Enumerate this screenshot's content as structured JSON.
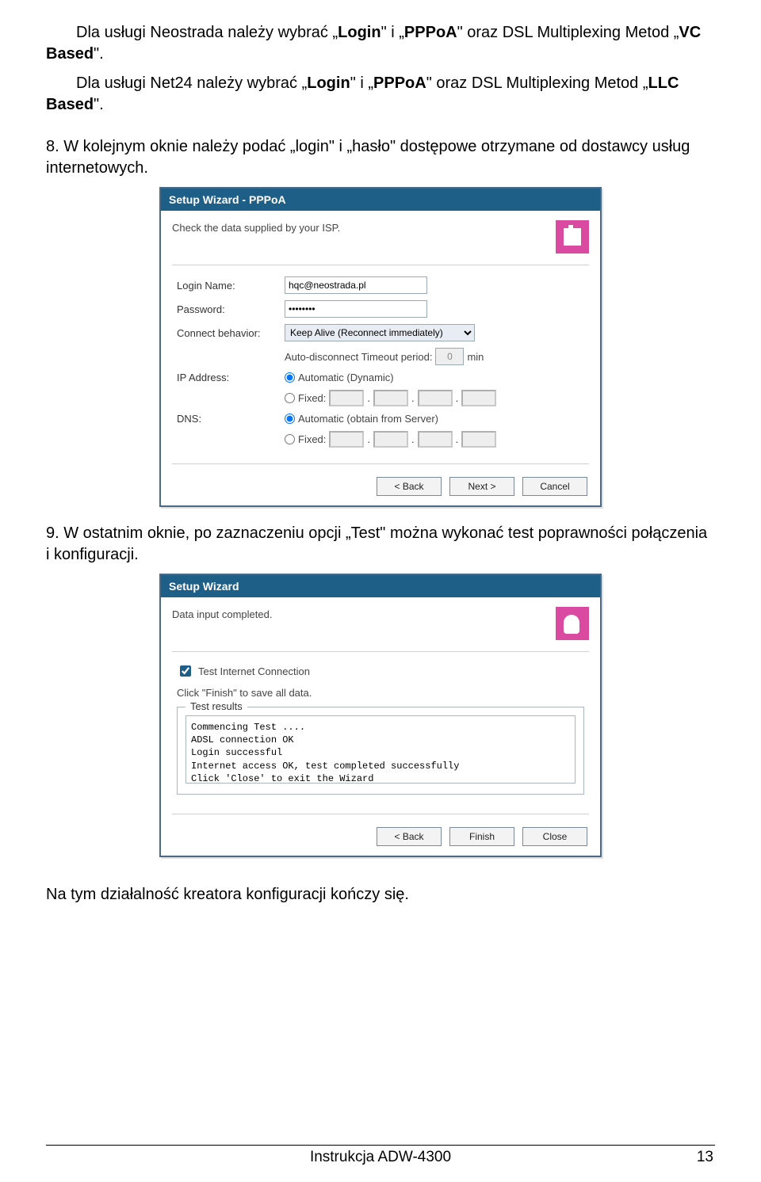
{
  "text": {
    "intro1_pre": "Dla usługi Neostrada należy wybrać „",
    "intro1_b1": "Login",
    "intro1_mid": "\" i „",
    "intro1_b2": "PPPoA",
    "intro1_after": "\" oraz DSL Multiplexing Metod „",
    "intro1_b3": "VC Based",
    "intro1_end": "\".",
    "intro2_pre": "Dla usługi Net24 należy wybrać „",
    "intro2_b1": "Login",
    "intro2_mid": "\" i „",
    "intro2_b2": "PPPoA",
    "intro2_after": "\" oraz DSL Multiplexing Metod „",
    "intro2_b3": "LLC Based",
    "intro2_end": "\".",
    "step8": "8. W kolejnym oknie należy podać „login\" i „hasło\" dostępowe otrzymane od dostawcy usług internetowych.",
    "step9": "9. W ostatnim oknie, po zaznaczeniu opcji „Test\" można wykonać test poprawności połączenia i konfiguracji.",
    "closing": "Na tym działalność kreatora konfiguracji kończy się."
  },
  "wizard1": {
    "title": "Setup Wizard - PPPoA",
    "intro": "Check the data supplied by your ISP.",
    "labels": {
      "login": "Login Name:",
      "password": "Password:",
      "connect": "Connect behavior:",
      "timeout_prefix": "Auto-disconnect Timeout period:",
      "timeout_unit": "min",
      "ip": "IP Address:",
      "dns": "DNS:",
      "auto_dyn": "Automatic (Dynamic)",
      "fixed": "Fixed:",
      "auto_srv": "Automatic (obtain from Server)"
    },
    "values": {
      "login": "hqc@neostrada.pl",
      "password": "••••••••",
      "connect": "Keep Alive (Reconnect immediately)",
      "timeout": "0"
    },
    "buttons": {
      "back": "< Back",
      "next": "Next >",
      "cancel": "Cancel"
    }
  },
  "wizard2": {
    "title": "Setup Wizard",
    "intro": "Data input completed.",
    "check_label": "Test Internet Connection",
    "save_hint": "Click \"Finish\" to save all data.",
    "fieldset": "Test results",
    "results": "Commencing Test ....\nADSL connection OK\nLogin successful\nInternet access OK, test completed successfully\nClick 'Close' to exit the Wizard",
    "buttons": {
      "back": "< Back",
      "finish": "Finish",
      "close": "Close"
    }
  },
  "footer": {
    "center": "Instrukcja ADW-4300",
    "page": "13"
  }
}
